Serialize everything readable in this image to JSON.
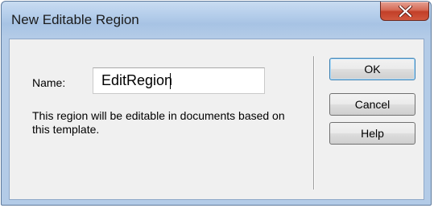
{
  "window": {
    "title": "New Editable Region"
  },
  "form": {
    "name_label": "Name:",
    "name_value": "EditRegion",
    "description": "This region will be editable in documents based on this template."
  },
  "buttons": {
    "ok_label": "OK",
    "cancel_label": "Cancel",
    "help_label": "Help"
  },
  "icons": {
    "close": "close-icon"
  },
  "colors": {
    "titlebar": "#b8d0ec",
    "close_button": "#c94a33",
    "dialog_body": "#f0f0f0",
    "default_button_border": "#3c7fb1"
  }
}
